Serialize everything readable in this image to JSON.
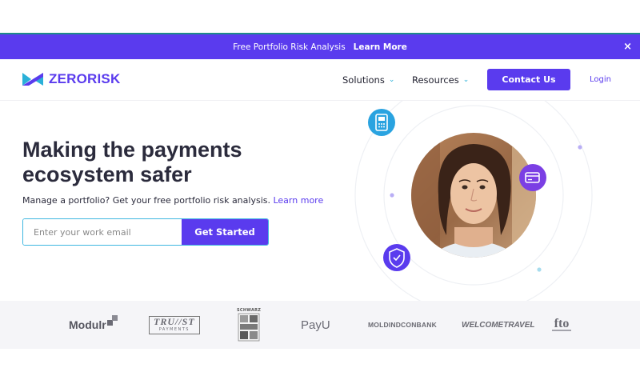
{
  "banner": {
    "text": "Free Portfolio Risk Analysis",
    "link": "Learn More",
    "close": "×"
  },
  "brand": {
    "name": "ZERORISK",
    "color": "#5a3bee"
  },
  "nav": {
    "items": [
      {
        "label": "Solutions",
        "icon": "chevron-down-icon"
      },
      {
        "label": "Resources",
        "icon": "chevron-down-icon"
      }
    ],
    "contact": "Contact Us",
    "login": "Login"
  },
  "hero": {
    "title_line1": "Making the payments",
    "title_line2": "ecosystem safer",
    "subtitle": "Manage a portfolio? Get your free portfolio risk analysis.",
    "learn_more": "Learn more",
    "email_placeholder": "Enter your work email",
    "cta": "Get Started",
    "orbit_icons": [
      "payment-terminal-icon",
      "credit-card-icon",
      "shield-check-icon"
    ]
  },
  "partners": [
    {
      "name": "Modulr"
    },
    {
      "name": "TRU//ST",
      "sub": "PAYMENTS"
    },
    {
      "name": "SCHWARZ"
    },
    {
      "name": "PayU"
    },
    {
      "name": "MOLDINDCONBANK"
    },
    {
      "name": "WELCOMETRAVEL"
    },
    {
      "name": "fto"
    }
  ],
  "colors": {
    "accent": "#5a3bee",
    "cyan": "#2ab0d8",
    "text": "#2b2b3c"
  }
}
